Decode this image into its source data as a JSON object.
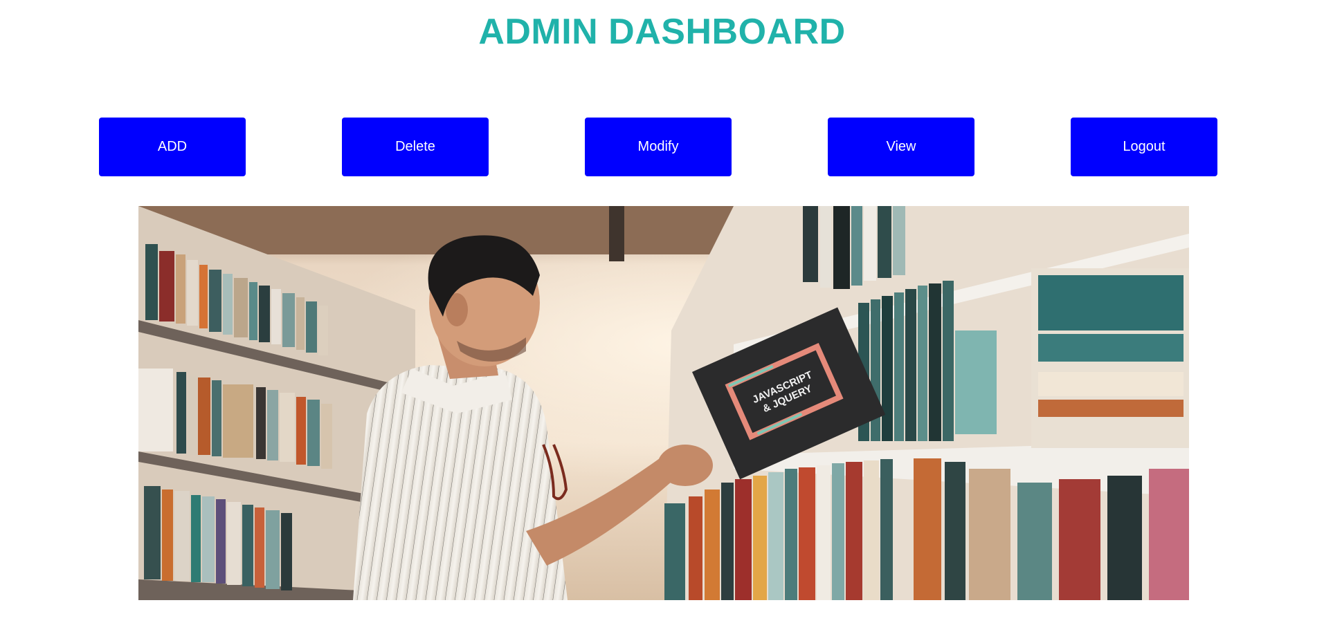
{
  "header": {
    "title": "ADMIN DASHBOARD"
  },
  "actions": {
    "add_label": "ADD",
    "delete_label": "Delete",
    "modify_label": "Modify",
    "view_label": "View",
    "logout_label": "Logout"
  },
  "hero": {
    "book_title_line1": "JAVASCRIPT",
    "book_title_line2": "& JQUERY"
  },
  "colors": {
    "title": "#20b2aa",
    "button_bg": "#0000ff",
    "button_text": "#ffffff",
    "background": "#ffffff"
  }
}
